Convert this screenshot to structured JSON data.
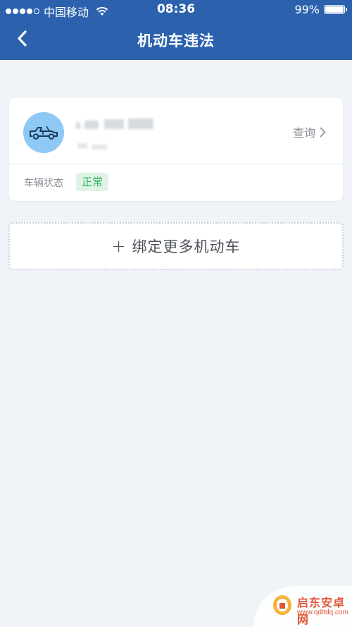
{
  "status_bar": {
    "carrier": "中国移动",
    "time": "08:36",
    "battery": "99%",
    "battery_level": 0.99
  },
  "nav": {
    "title": "机动车违法",
    "back_icon": "chevron-left-icon"
  },
  "vehicle_card": {
    "avatar_icon": "car-icon",
    "query_label": "查询",
    "status_label": "车辆状态",
    "status_value": "正常"
  },
  "bind_more": {
    "plus": "+",
    "label": "绑定更多机动车"
  },
  "watermark": {
    "name": "启东安卓网",
    "url": "www.qdltdq.com"
  },
  "colors": {
    "header": "#2c62ad",
    "background": "#f0f4f8",
    "avatar": "#8ec8f4",
    "status_ok": "#2bae5a"
  }
}
